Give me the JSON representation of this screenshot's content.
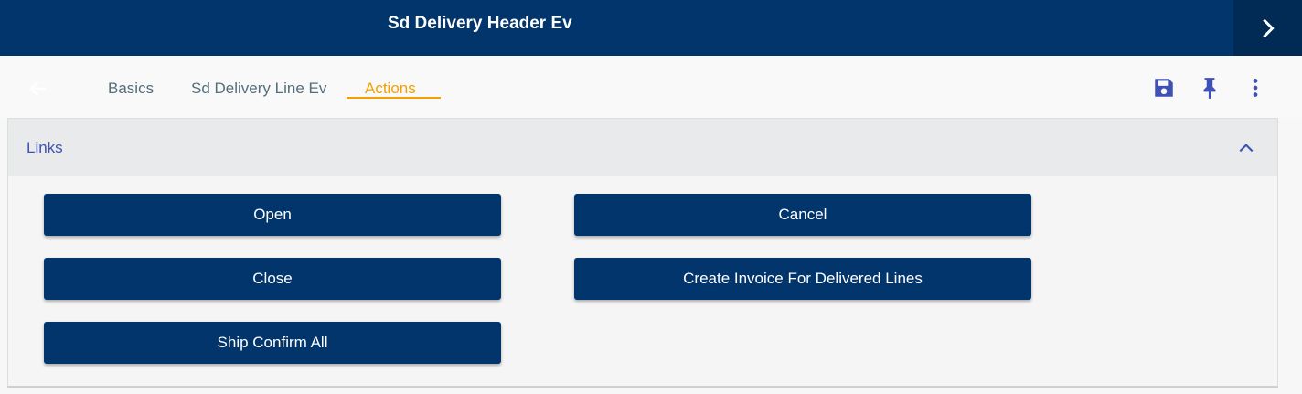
{
  "header": {
    "title": "Sd Delivery Header Ev"
  },
  "tabs": [
    {
      "label": "Basics",
      "active": false
    },
    {
      "label": "Sd Delivery Line Ev",
      "active": false
    },
    {
      "label": "Actions",
      "active": true
    }
  ],
  "toolbar": {
    "icons": [
      "save-icon",
      "pin-icon",
      "more-vert-icon"
    ]
  },
  "section": {
    "title": "Links",
    "expanded": true
  },
  "actions": {
    "open": "Open",
    "cancel": "Cancel",
    "close": "Close",
    "create_invoice": "Create Invoice For Delivered Lines",
    "ship_confirm_all": "Ship Confirm All"
  },
  "colors": {
    "primary": "#02356b",
    "active_tab": "#f5a000",
    "toolbar_icon": "#3f51b5"
  }
}
